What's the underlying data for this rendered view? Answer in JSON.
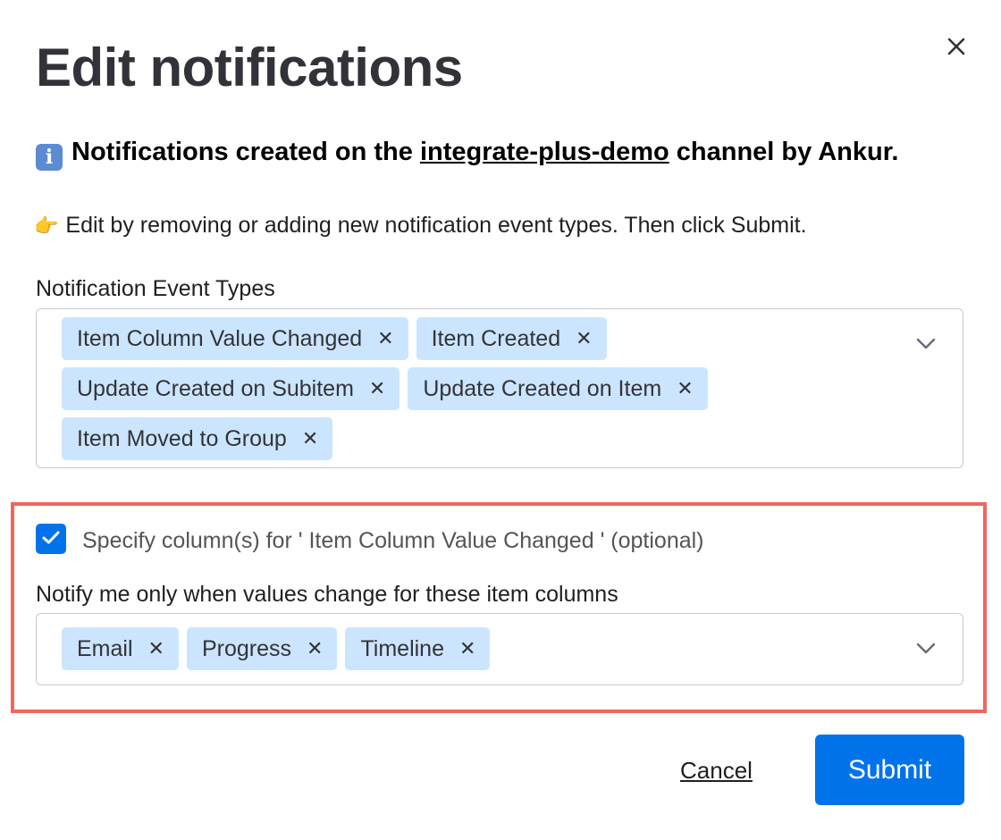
{
  "dialog": {
    "title": "Edit notifications",
    "close_icon": "close-icon"
  },
  "info": {
    "icon": "information-icon",
    "icon_glyph": "i",
    "prefix": "Notifications created on the ",
    "channel": "integrate-plus-demo",
    "suffix": " channel by Ankur."
  },
  "instruction": {
    "icon": "pointing-hand-icon",
    "icon_glyph": "👉",
    "text": "Edit by removing or adding new notification event types. Then click Submit."
  },
  "event_types": {
    "label": "Notification Event Types",
    "selected": [
      "Item Column Value Changed",
      "Item Created",
      "Update Created on Subitem",
      "Update Created on Item",
      "Item Moved to Group"
    ],
    "remove_glyph": "✕",
    "dropdown_icon": "chevron-down-icon"
  },
  "column_filter": {
    "checkbox_checked": true,
    "checkbox_label": "Specify column(s) for ' Item Column Value Changed ' (optional)",
    "label": "Notify me only when values change for these item columns",
    "selected": [
      "Email",
      "Progress",
      "Timeline"
    ],
    "remove_glyph": "✕",
    "dropdown_icon": "chevron-down-icon"
  },
  "footer": {
    "cancel_label": "Cancel",
    "submit_label": "Submit"
  },
  "colors": {
    "primary": "#0073ea",
    "chip_bg": "#cce5ff",
    "highlight_border": "#f0665c",
    "text": "#323338"
  }
}
